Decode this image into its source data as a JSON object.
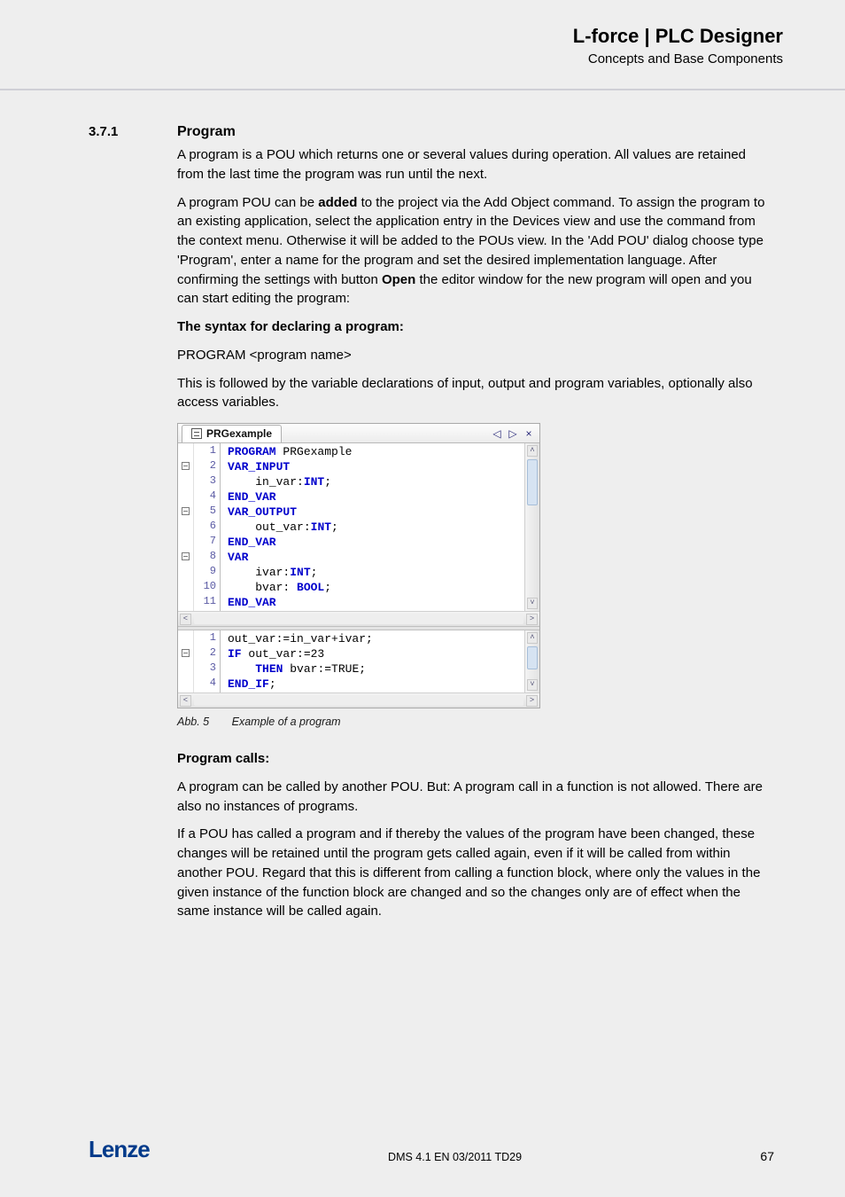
{
  "header": {
    "title": "L-force | PLC Designer",
    "subtitle": "Concepts and Base Components"
  },
  "section": {
    "number": "3.7.1",
    "title": "Program"
  },
  "para1a": "A program is a POU which returns one or several values during operation. All values are retained from the last time the program was run until the next.",
  "para2_lead": "A program POU can be ",
  "para2_bold1": "added",
  "para2_mid": " to the project via the Add Object command. To assign the program to an existing application, select the application entry in the Devices view and use the command from the context menu. Otherwise it will be added to the POUs view. In the 'Add POU' dialog choose type 'Program', enter a name for the program and set the desired implementation language. After confirming the settings with button ",
  "para2_bold2": "Open",
  "para2_tail": " the editor window for the new program will open and you can start editing the program:",
  "syntax_title": "The syntax for declaring a program:",
  "syntax_line": "PROGRAM <program name>",
  "para3": "This is followed by the variable declarations of input, output and program variables, optionally also access variables.",
  "editor": {
    "tab_label": "PRGexample",
    "tab_ctrls": {
      "left": "◁",
      "right": "▷",
      "close": "×"
    },
    "scroll": {
      "up": "˄",
      "down": "˅",
      "left": "˂",
      "right": "˃"
    },
    "decl": [
      {
        "ln": "1",
        "fold": "",
        "html": "<span class='kw-tok'>PROGRAM</span> <span class='kw-plain'>PRGexample</span>"
      },
      {
        "ln": "2",
        "fold": "-",
        "html": "<span class='kw-tok'>VAR_INPUT</span>"
      },
      {
        "ln": "3",
        "fold": "",
        "html": "    <span class='kw-plain'>in_var:</span><span class='kw-tok'>INT</span><span class='kw-plain'>;</span>"
      },
      {
        "ln": "4",
        "fold": "",
        "html": "<span class='kw-tok'>END_VAR</span>"
      },
      {
        "ln": "5",
        "fold": "-",
        "html": "<span class='kw-tok'>VAR_OUTPUT</span>"
      },
      {
        "ln": "6",
        "fold": "",
        "html": "    <span class='kw-plain'>out_var:</span><span class='kw-tok'>INT</span><span class='kw-plain'>;</span>"
      },
      {
        "ln": "7",
        "fold": "",
        "html": "<span class='kw-tok'>END_VAR</span>"
      },
      {
        "ln": "8",
        "fold": "-",
        "html": "<span class='kw-tok'>VAR</span>"
      },
      {
        "ln": "9",
        "fold": "",
        "html": "    <span class='kw-plain'>ivar:</span><span class='kw-tok'>INT</span><span class='kw-plain'>;</span>"
      },
      {
        "ln": "10",
        "fold": "",
        "html": "    <span class='kw-plain'>bvar: </span><span class='kw-tok'>BOOL</span><span class='kw-plain'>;</span>"
      },
      {
        "ln": "11",
        "fold": "",
        "html": "<span class='kw-tok'>END_VAR</span>"
      }
    ],
    "impl": [
      {
        "ln": "1",
        "fold": "",
        "html": "<span class='kw-plain'>out_var:=in_var+ivar;</span>"
      },
      {
        "ln": "2",
        "fold": "-",
        "html": "<span class='kw-tok'>IF</span><span class='kw-plain'> out_var:=23</span>"
      },
      {
        "ln": "3",
        "fold": "",
        "html": "    <span class='kw-tok'>THEN</span><span class='kw-plain'> bvar:=</span><span class='kw-plain'>TRUE</span><span class='kw-plain'>;</span>"
      },
      {
        "ln": "4",
        "fold": "",
        "html": "<span class='kw-tok'>END_IF</span><span class='kw-plain'>;</span>"
      }
    ]
  },
  "caption": {
    "abb": "Abb. 5",
    "text": "Example of a program"
  },
  "calls_title": "Program calls:",
  "calls_p1": "A program can be called by another POU. But: A program call in a function is not allowed. There are also no instances of programs.",
  "calls_p2": "If a POU has called a program and if thereby the values of the program have been changed, these changes will be retained until the program gets called again, even if it will be called from within another POU. Regard that this is different from calling a function block, where only the values in the given instance of the function block are changed and so the changes only are of effect when the same instance will be called again.",
  "footer": {
    "logo": "Lenze",
    "docid": "DMS 4.1 EN 03/2011 TD29",
    "page": "67"
  }
}
